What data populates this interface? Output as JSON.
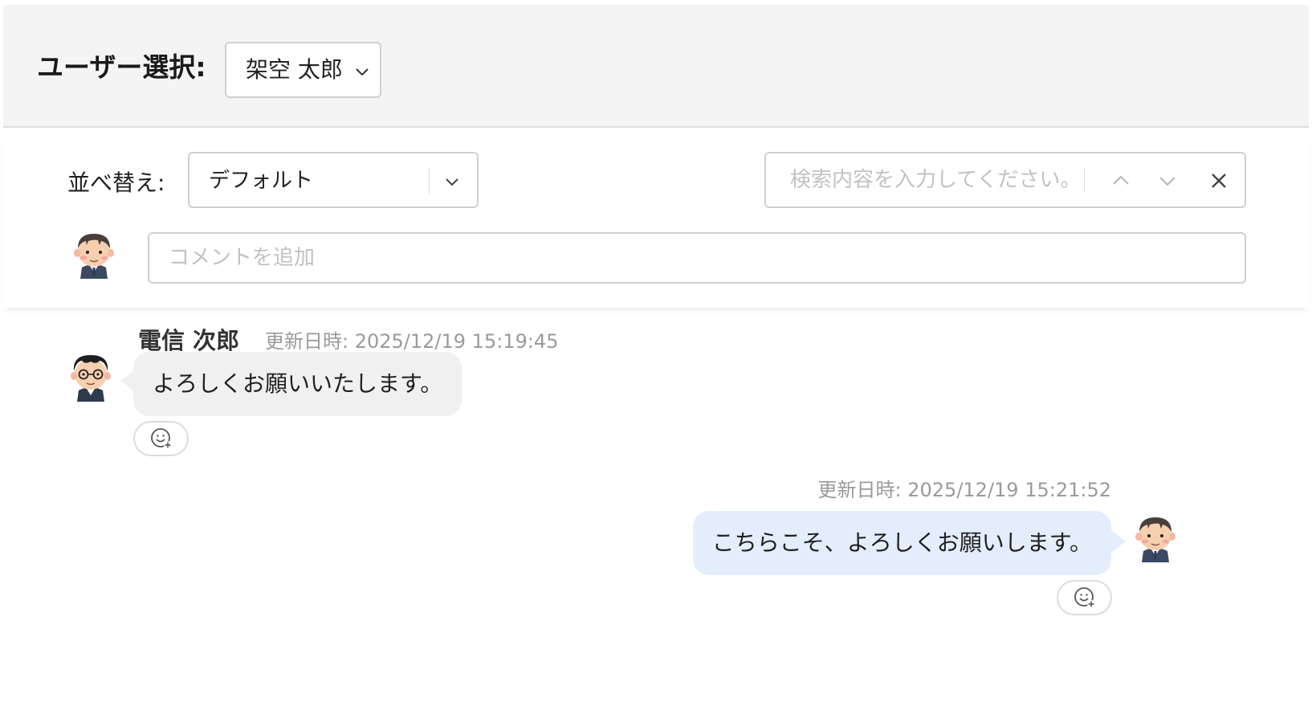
{
  "user_select": {
    "label": "ユーザー選択:",
    "value": "架空 太郎"
  },
  "toolbar": {
    "sort_label": "並べ替え:",
    "sort_value": "デフォルト",
    "search_placeholder": "検索内容を入力してください。",
    "comment_placeholder": "コメントを追加"
  },
  "messages": [
    {
      "author": "電信 次郎",
      "timestamp": "更新日時: 2025/12/19 15:19:45",
      "text": "よろしくお願いいたします。",
      "side": "left"
    },
    {
      "author": "",
      "timestamp": "更新日時: 2025/12/19 15:21:52",
      "text": "こちらこそ、よろしくお願いします。",
      "side": "right"
    }
  ],
  "colors": {
    "header_bg": "#f4f4f4",
    "bubble_left": "#f0f0f0",
    "bubble_right": "#e3edfb",
    "timestamp": "#9a9a9a"
  },
  "icons": [
    "chevron-down-icon",
    "chevron-up-icon",
    "close-icon",
    "add-reaction-icon",
    "avatar"
  ]
}
